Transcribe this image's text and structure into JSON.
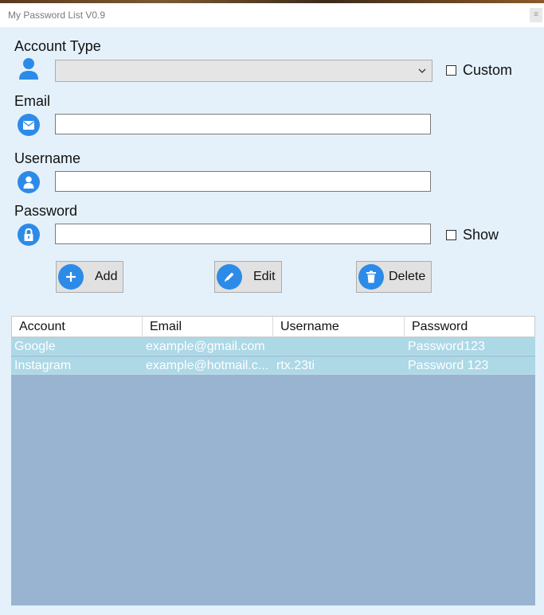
{
  "window": {
    "title": "My Password List V0.9",
    "close_glyph": "≡"
  },
  "form": {
    "account_type_label": "Account Type",
    "account_type_value": "",
    "custom_label": "Custom",
    "email_label": "Email",
    "email_value": "",
    "username_label": "Username",
    "username_value": "",
    "password_label": "Password",
    "password_value": "",
    "show_label": "Show"
  },
  "buttons": {
    "add": "Add",
    "edit": "Edit",
    "delete": "Delete"
  },
  "table": {
    "headers": [
      "Account",
      "Email",
      "Username",
      "Password"
    ],
    "rows": [
      [
        "Google",
        "example@gmail.com",
        "",
        "Password123"
      ],
      [
        "Instagram",
        "example@hotmail.c...",
        "rtx.23ti",
        "Password 123"
      ]
    ]
  },
  "colors": {
    "accent": "#2d8be8",
    "form_bg": "#e4f1fb",
    "grid_bg": "#98b4d1",
    "row_bg": "#add8e6"
  },
  "icons": [
    "user-icon",
    "mail-icon",
    "user-circle-icon",
    "lock-icon",
    "plus-icon",
    "pencil-icon",
    "trash-icon",
    "chevron-down-icon"
  ]
}
